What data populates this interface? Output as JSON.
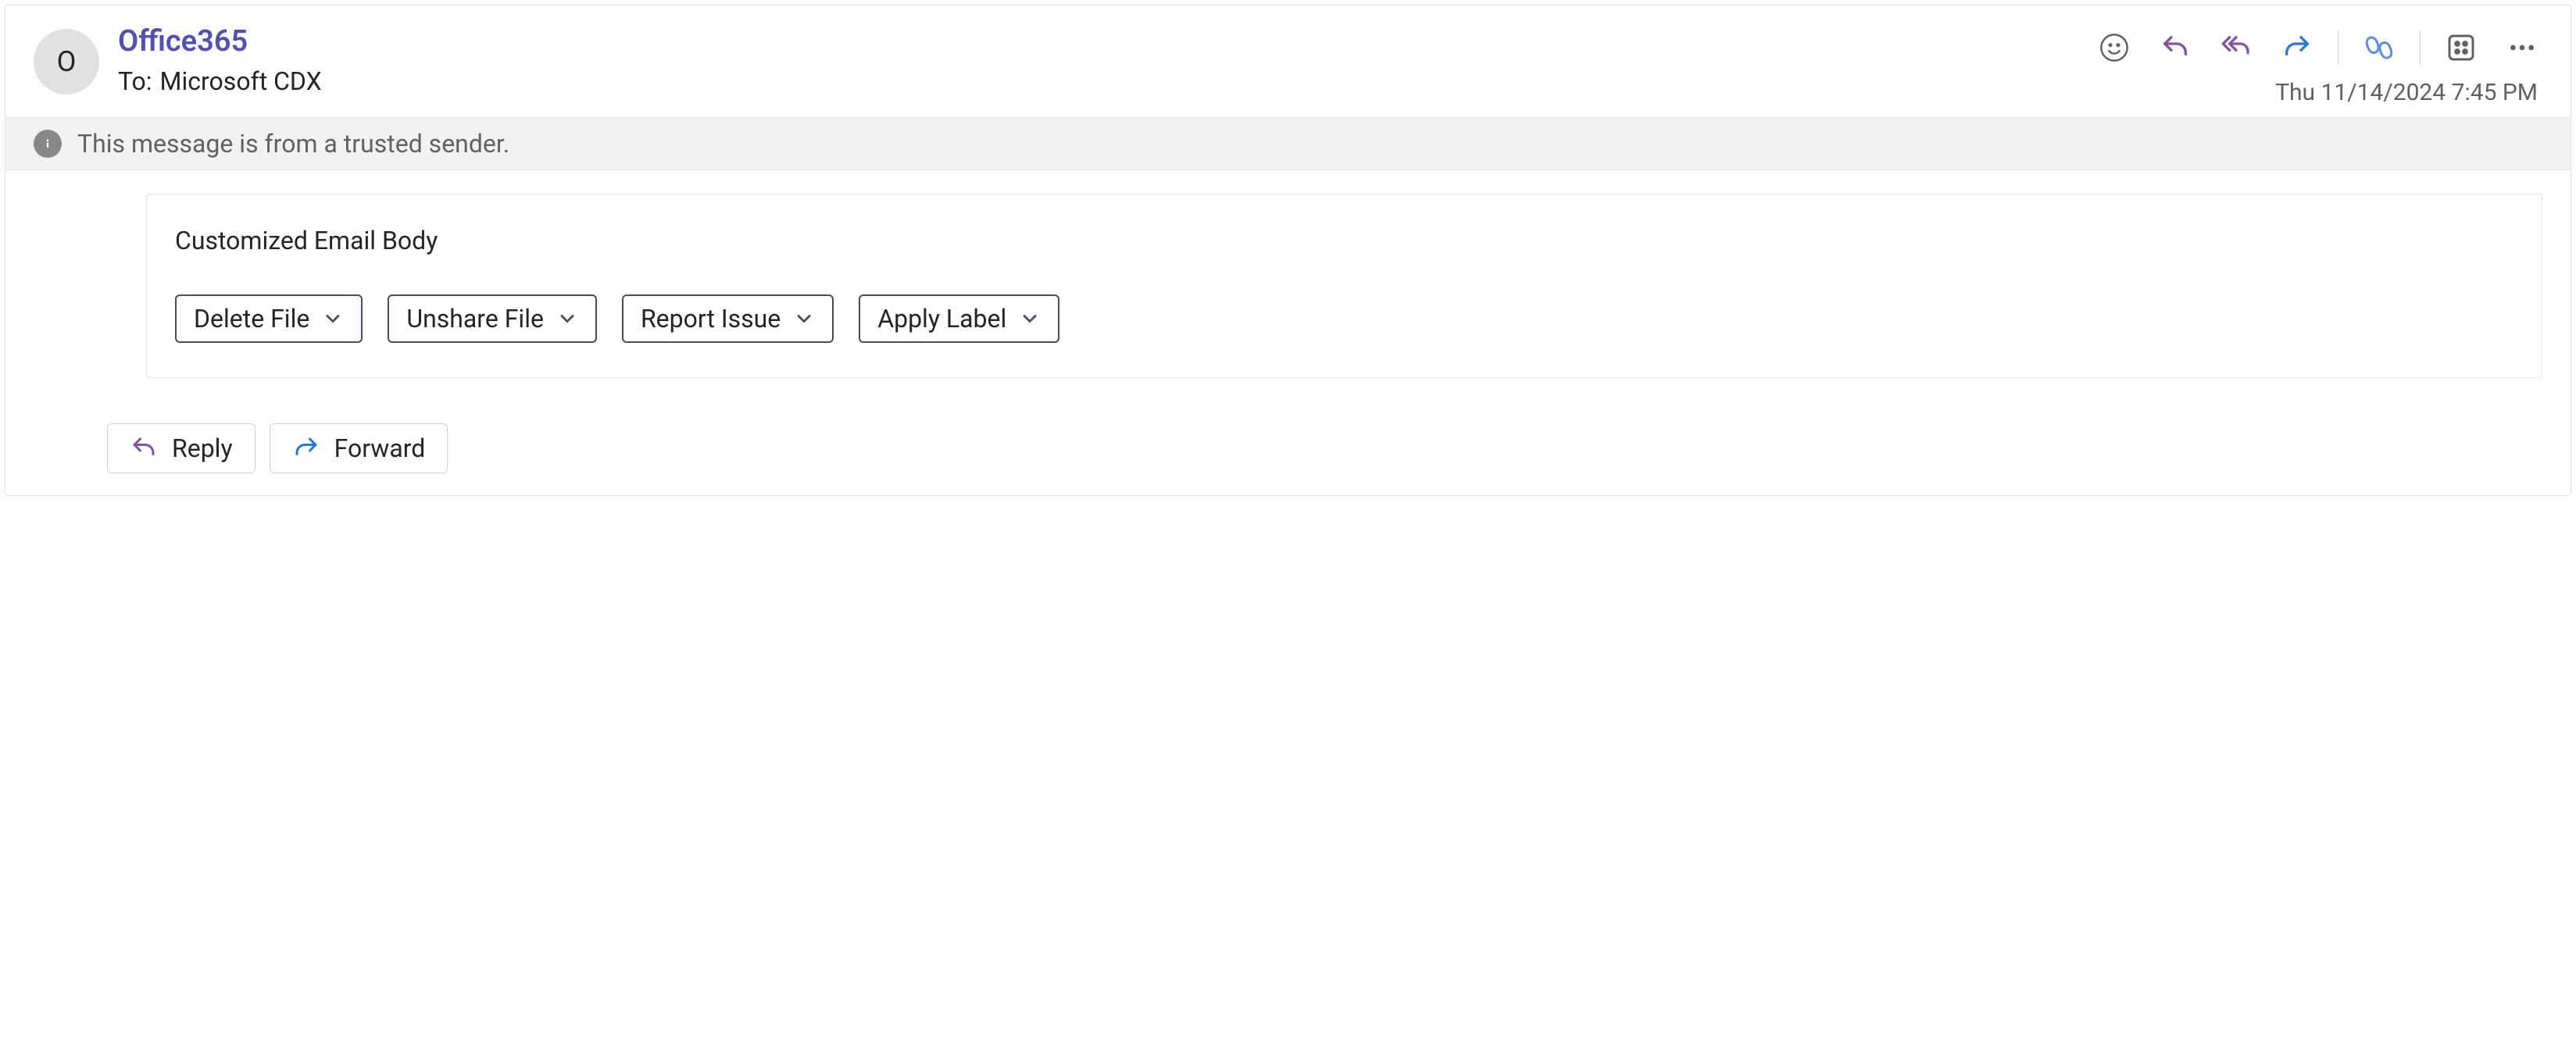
{
  "header": {
    "sender": "Office365",
    "avatar_initial": "O",
    "to_label": "To:",
    "to_value": "Microsoft CDX",
    "timestamp": "Thu 11/14/2024 7:45 PM"
  },
  "banner": {
    "text": "This message is from a trusted sender."
  },
  "body": {
    "text": "Customized Email Body",
    "buttons": {
      "delete": "Delete File",
      "unshare": "Unshare File",
      "report": "Report Issue",
      "apply_label": "Apply Label"
    }
  },
  "footer": {
    "reply": "Reply",
    "forward": "Forward"
  },
  "colors": {
    "accent_purple": "#8152a2",
    "accent_blue": "#2a77d6"
  }
}
